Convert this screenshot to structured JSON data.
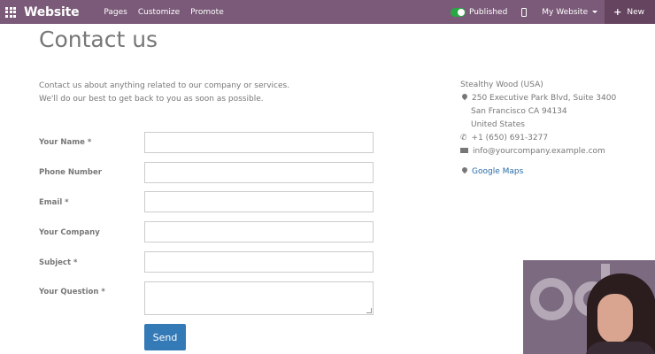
{
  "topbar": {
    "brand": "Website",
    "menu": [
      "Pages",
      "Customize",
      "Promote"
    ],
    "published_label": "Published",
    "published_on": true,
    "site_selector": "My Website",
    "new_label": "New"
  },
  "page": {
    "title": "Contact us",
    "intro_line1": "Contact us about anything related to our company or services.",
    "intro_line2": "We'll do our best to get back to you as soon as possible."
  },
  "form": {
    "fields": [
      {
        "label": "Your Name *",
        "value": ""
      },
      {
        "label": "Phone Number",
        "value": ""
      },
      {
        "label": "Email *",
        "value": ""
      },
      {
        "label": "Your Company",
        "value": ""
      },
      {
        "label": "Subject *",
        "value": ""
      },
      {
        "label": "Your Question *",
        "value": ""
      }
    ],
    "send_label": "Send"
  },
  "address": {
    "company": "Stealthy Wood (USA)",
    "street": "250 Executive Park Blvd, Suite 3400",
    "city": "San Francisco CA 94134",
    "country": "United States",
    "phone": "+1 (650) 691-3277",
    "email": "info@yourcompany.example.com",
    "maps_label": "Google Maps"
  },
  "colors": {
    "topbar": "#7a5a78",
    "toggle_on": "#28a745",
    "send_button": "#337ab7",
    "link": "#2a6ca8"
  },
  "icons": [
    "apps-grid-icon",
    "toggle-icon",
    "mobile-preview-icon",
    "caret-down-icon",
    "plus-icon",
    "map-marker-icon",
    "phone-icon",
    "envelope-icon"
  ]
}
